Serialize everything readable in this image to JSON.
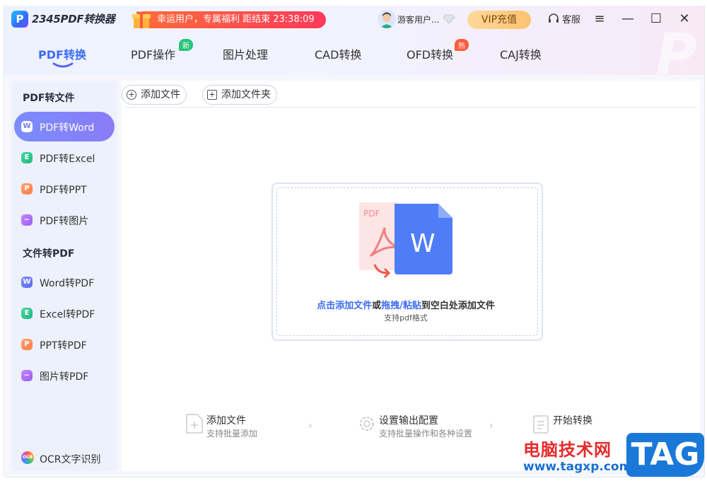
{
  "app": {
    "logo_letter": "P",
    "name": "2345PDF转换器"
  },
  "promo": {
    "text": "幸运用户，专属福利 距结束 23:38:09"
  },
  "user": {
    "name": "游客用户..."
  },
  "vip_button": "VIP充值",
  "service_label": "客服",
  "window_controls": {
    "menu": "≡",
    "maximize": "☐",
    "close": "✕"
  },
  "tabs": [
    {
      "label": "PDF转换",
      "active": true
    },
    {
      "label": "PDF操作",
      "badge": "新"
    },
    {
      "label": "图片处理"
    },
    {
      "label": "CAD转换"
    },
    {
      "label": "OFD转换",
      "badge": "热"
    },
    {
      "label": "CAJ转换"
    }
  ],
  "sidebar": {
    "section1": "PDF转文件",
    "items1": [
      {
        "label": "PDF转Word",
        "icon": "W",
        "active": true
      },
      {
        "label": "PDF转Excel",
        "icon": "E"
      },
      {
        "label": "PDF转PPT",
        "icon": "P"
      },
      {
        "label": "PDF转图片",
        "icon": "~"
      }
    ],
    "section2": "文件转PDF",
    "items2": [
      {
        "label": "Word转PDF",
        "icon": "W"
      },
      {
        "label": "Excel转PDF",
        "icon": "E"
      },
      {
        "label": "PPT转PDF",
        "icon": "P"
      },
      {
        "label": "图片转PDF",
        "icon": "~"
      }
    ],
    "ocr": {
      "label": "OCR文字识别",
      "icon_text": "OCR"
    }
  },
  "toolbar": {
    "add_file": "添加文件",
    "add_folder": "添加文件夹"
  },
  "dropzone": {
    "pdf_tag": "PDF",
    "word_letter": "W",
    "line1": {
      "a": "点击添加文件",
      "b": "或",
      "c": "拖拽/粘贴",
      "d": "到空白处添加文件"
    },
    "line2": "支持pdf格式"
  },
  "steps": [
    {
      "title": "添加文件",
      "sub": "支持批量添加"
    },
    {
      "title": "设置输出配置",
      "sub": "支持批量操作和各种设置"
    },
    {
      "title": "开始转换",
      "sub": ""
    }
  ],
  "watermark": {
    "cn": "电脑技术网",
    "url": "www.tagxp.com",
    "tag": "TAG"
  },
  "colors": {
    "accent": "#3c6cf5",
    "promo": "#ff4a4a",
    "vip": "#fbc36e",
    "sidebar_active": "#7b8cff"
  }
}
